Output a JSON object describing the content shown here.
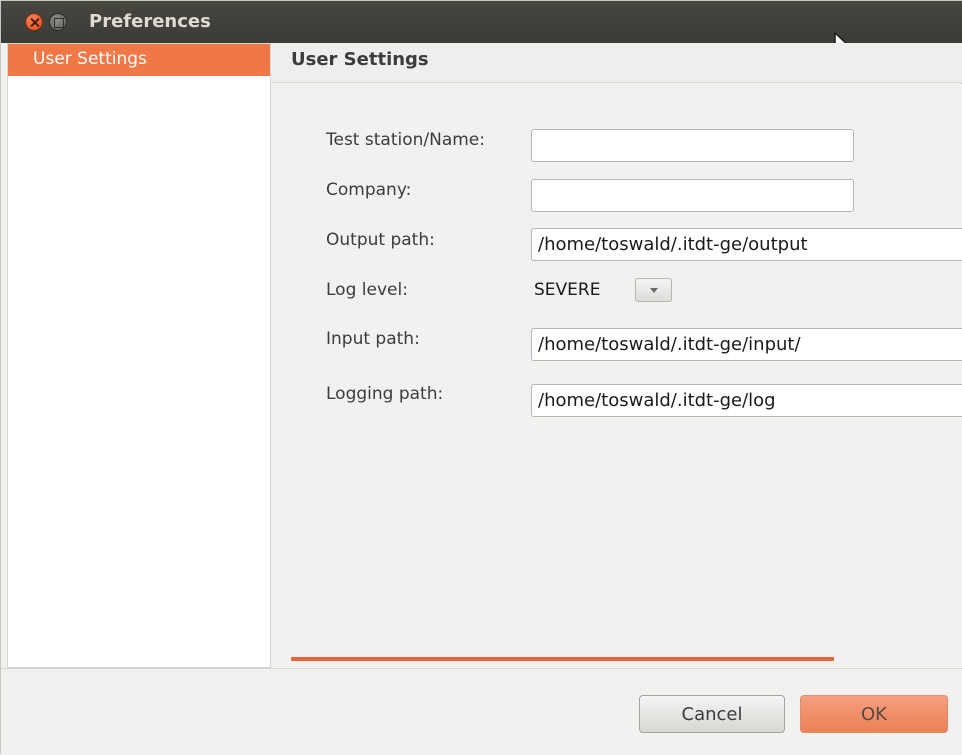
{
  "window": {
    "title": "Preferences"
  },
  "sidebar": {
    "items": [
      {
        "label": "User Settings",
        "selected": true
      }
    ]
  },
  "panel": {
    "title": "User Settings"
  },
  "form": {
    "test_station": {
      "label": "Test station/Name:",
      "value": ""
    },
    "company": {
      "label": "Company:",
      "value": ""
    },
    "output_path": {
      "label": "Output path:",
      "value": "/home/toswald/.itdt-ge/output"
    },
    "log_level": {
      "label": "Log level:",
      "value": "SEVERE"
    },
    "input_path": {
      "label": "Input path:",
      "value": "/home/toswald/.itdt-ge/input/"
    },
    "logging_path": {
      "label": "Logging path:",
      "value": "/home/toswald/.itdt-ge/log"
    }
  },
  "buttons": {
    "cancel": "Cancel",
    "ok": "OK"
  },
  "colors": {
    "accent": "#f07746",
    "titlebar": "#3c3b37",
    "ok_button": "#ec8056"
  },
  "icons": {
    "close": "close-icon",
    "maximize": "maximize-icon",
    "dropdown": "chevron-down-icon",
    "cursor": "mouse-pointer-icon"
  }
}
